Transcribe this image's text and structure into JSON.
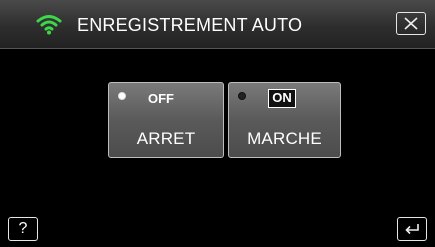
{
  "header": {
    "title": "ENREGISTREMENT AUTO",
    "wifi_icon": "wifi-icon",
    "close_icon": "close-icon"
  },
  "options": [
    {
      "tag": "OFF",
      "label": "ARRET",
      "selected": false
    },
    {
      "tag": "ON",
      "label": "MARCHE",
      "selected": true
    }
  ],
  "footer": {
    "help_label": "?",
    "back_icon": "return-icon"
  },
  "colors": {
    "wifi_green": "#3cd84a",
    "background": "#000000"
  }
}
